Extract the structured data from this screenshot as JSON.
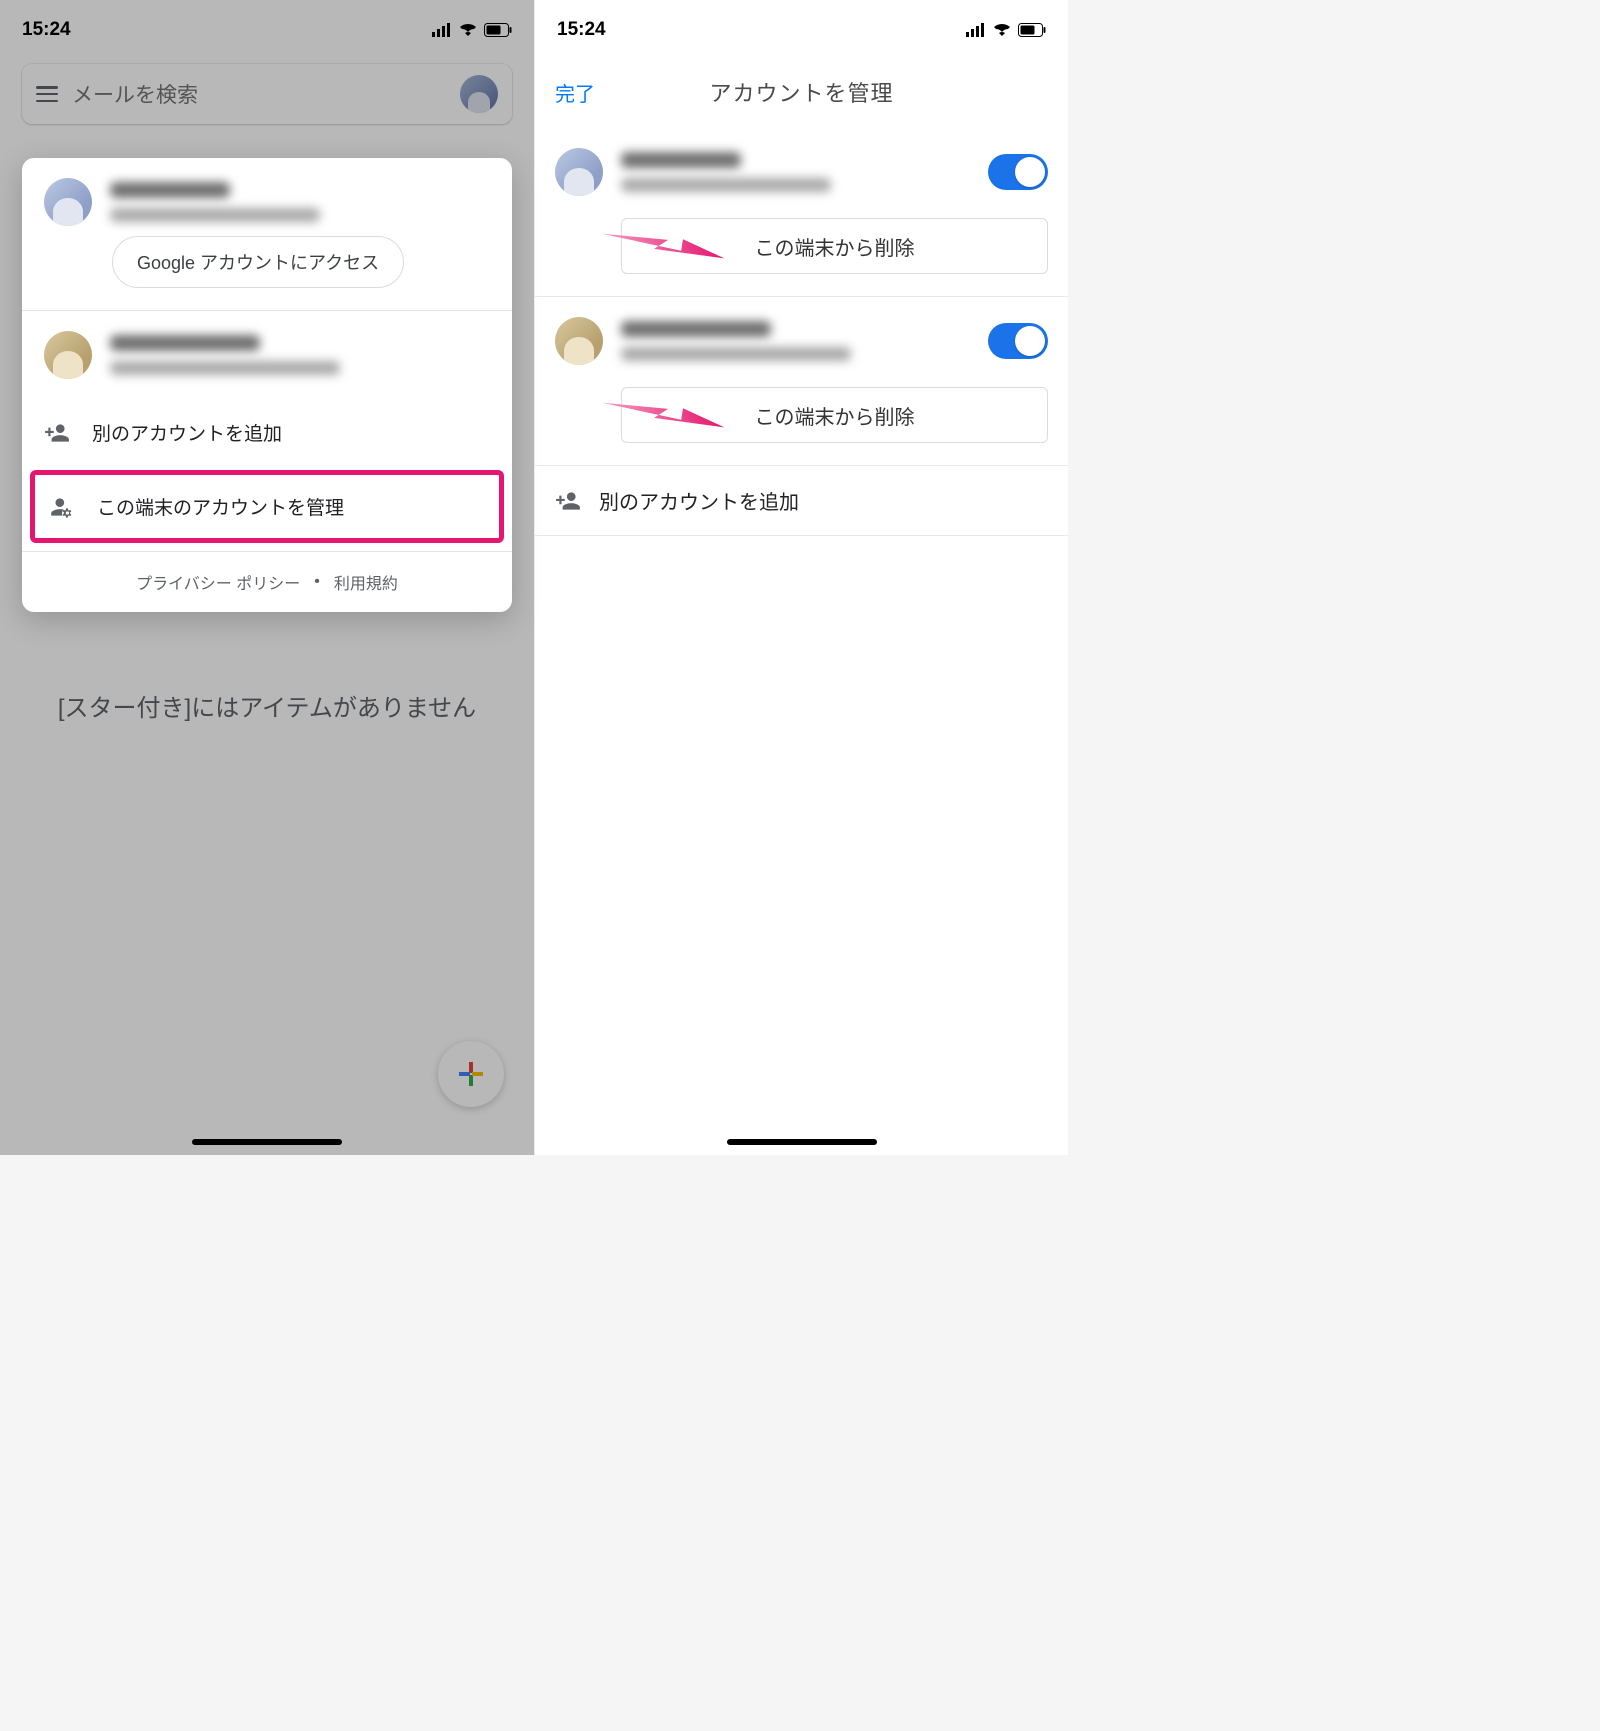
{
  "status": {
    "time": "15:24"
  },
  "left": {
    "search_placeholder": "メールを検索",
    "bg_empty": "[スター付き]にはアイテムがありません",
    "access_btn": "Google アカウントにアクセス",
    "add_account": "別のアカウントを追加",
    "manage_accounts": "この端末のアカウントを管理",
    "privacy": "プライバシー ポリシー",
    "terms": "利用規約"
  },
  "right": {
    "done": "完了",
    "title": "アカウントを管理",
    "remove_btn": "この端末から削除",
    "add_account": "別のアカウントを追加"
  }
}
